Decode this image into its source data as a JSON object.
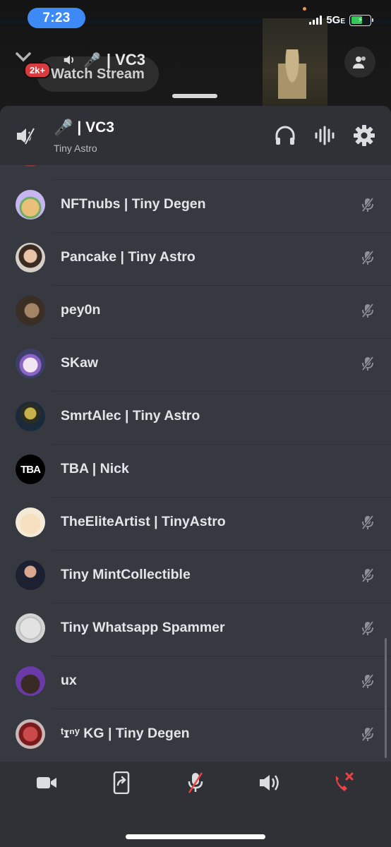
{
  "status_bar": {
    "time": "7:23",
    "network": "5G",
    "network_suffix": "E"
  },
  "background": {
    "badge": "2k+",
    "watch_stream": "Watch Stream",
    "title": "| VC3"
  },
  "header": {
    "title": "| VC3",
    "subtitle": "Tiny Astro"
  },
  "members": [
    {
      "name": "NFTnubs | Tiny Degen",
      "muted": true
    },
    {
      "name": "Pancake | Tiny Astro",
      "muted": true
    },
    {
      "name": "pey0n",
      "muted": true
    },
    {
      "name": "SKaw",
      "muted": true
    },
    {
      "name": "SmrtAlec | Tiny Astro",
      "muted": false
    },
    {
      "name": "TBA | Nick",
      "muted": false
    },
    {
      "name": "TheEliteArtist | TinyAstro",
      "muted": true
    },
    {
      "name": "Tiny MintCollectible",
      "muted": true
    },
    {
      "name": "Tiny Whatsapp Spammer",
      "muted": true
    },
    {
      "name": "ux",
      "muted": true
    },
    {
      "name": "ᵗɪⁿʸ KG | Tiny Degen",
      "muted": true
    }
  ],
  "avatar_text": {
    "tba": "TBA"
  },
  "colors": {
    "accent_blue": "#3d8af7",
    "danger_red": "#ed4245",
    "sheet_bg": "#36393f",
    "header_bg": "#2f3136"
  },
  "icons": [
    "chevron-down-icon",
    "speaker-icon",
    "microphone-icon",
    "people-icon",
    "headphones-icon",
    "voice-activity-icon",
    "gear-icon",
    "mute-icon",
    "camera-icon",
    "screen-share-icon",
    "speaker-icon",
    "hang-up-icon"
  ]
}
